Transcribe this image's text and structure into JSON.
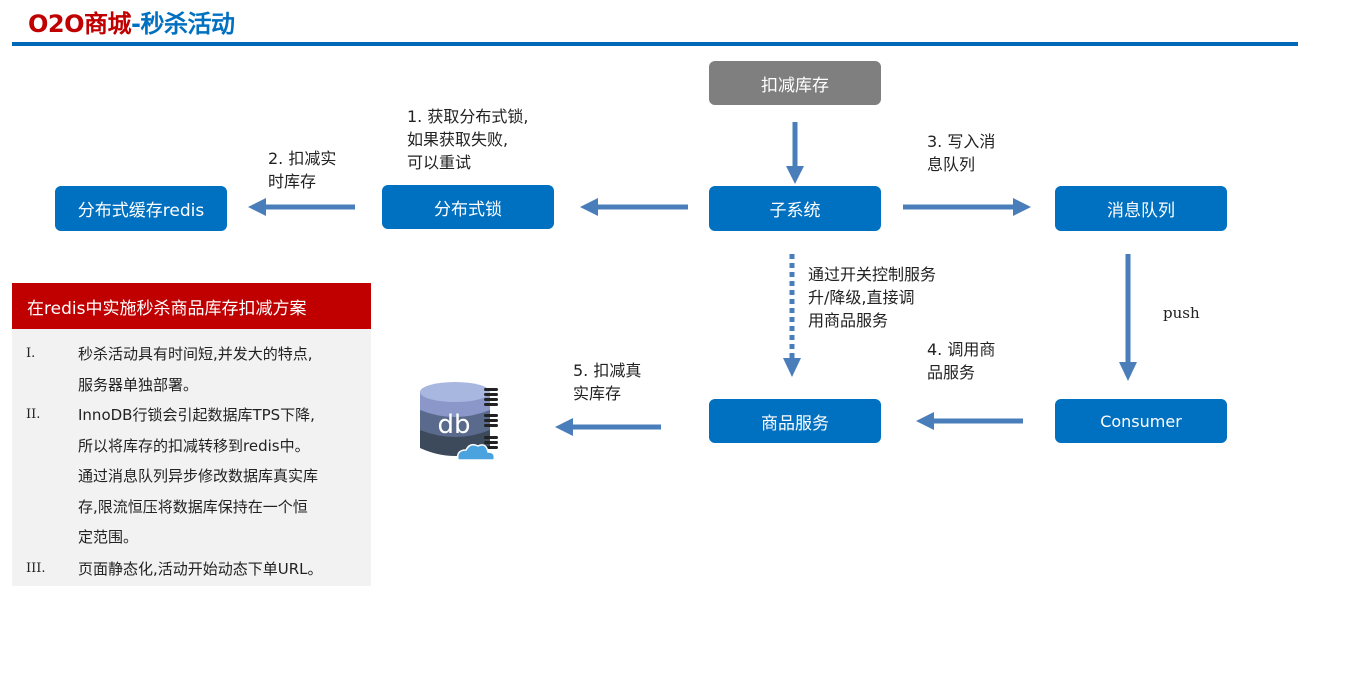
{
  "header": {
    "title_part1": "O2O商城",
    "title_part2": "-秒杀活动"
  },
  "nodes": {
    "deduct_stock": "扣减库存",
    "subsystem": "子系统",
    "dist_lock": "分布式锁",
    "dist_cache": "分布式缓存redis",
    "message_queue": "消息队列",
    "consumer": "Consumer",
    "product_service": "商品服务",
    "database": "db"
  },
  "edge_labels": {
    "step1": "1. 获取分布式锁,\n如果获取失败,\n可以重试",
    "step2": "2. 扣减实\n时库存",
    "step3": "3. 写入消\n息队列",
    "switch": "通过开关控制服务\n升/降级,直接调\n用商品服务",
    "push": "push",
    "step4": "4. 调用商\n品服务",
    "step5": "5. 扣减真\n实库存"
  },
  "colors": {
    "node_blue": "#0070c0",
    "node_gray": "#7f7f7f",
    "arrow": "#4a7ebb",
    "title_red": "#c00000",
    "title_blue": "#0070c0",
    "panel_head": "#c00000",
    "panel_bg": "#f2f2f2"
  },
  "panel": {
    "title": "在redis中实施秒杀商品库存扣减方案",
    "items": [
      {
        "num": "I.",
        "text": "秒杀活动具有时间短,并发大的特点,\n服务器单独部署。"
      },
      {
        "num": "II.",
        "text": "InnoDB行锁会引起数据库TPS下降,\n所以将库存的扣减转移到redis中。\n通过消息队列异步修改数据库真实库\n存,限流恒压将数据库保持在一个恒\n定范围。"
      },
      {
        "num": "III.",
        "text": "页面静态化,活动开始动态下单URL。"
      }
    ]
  }
}
